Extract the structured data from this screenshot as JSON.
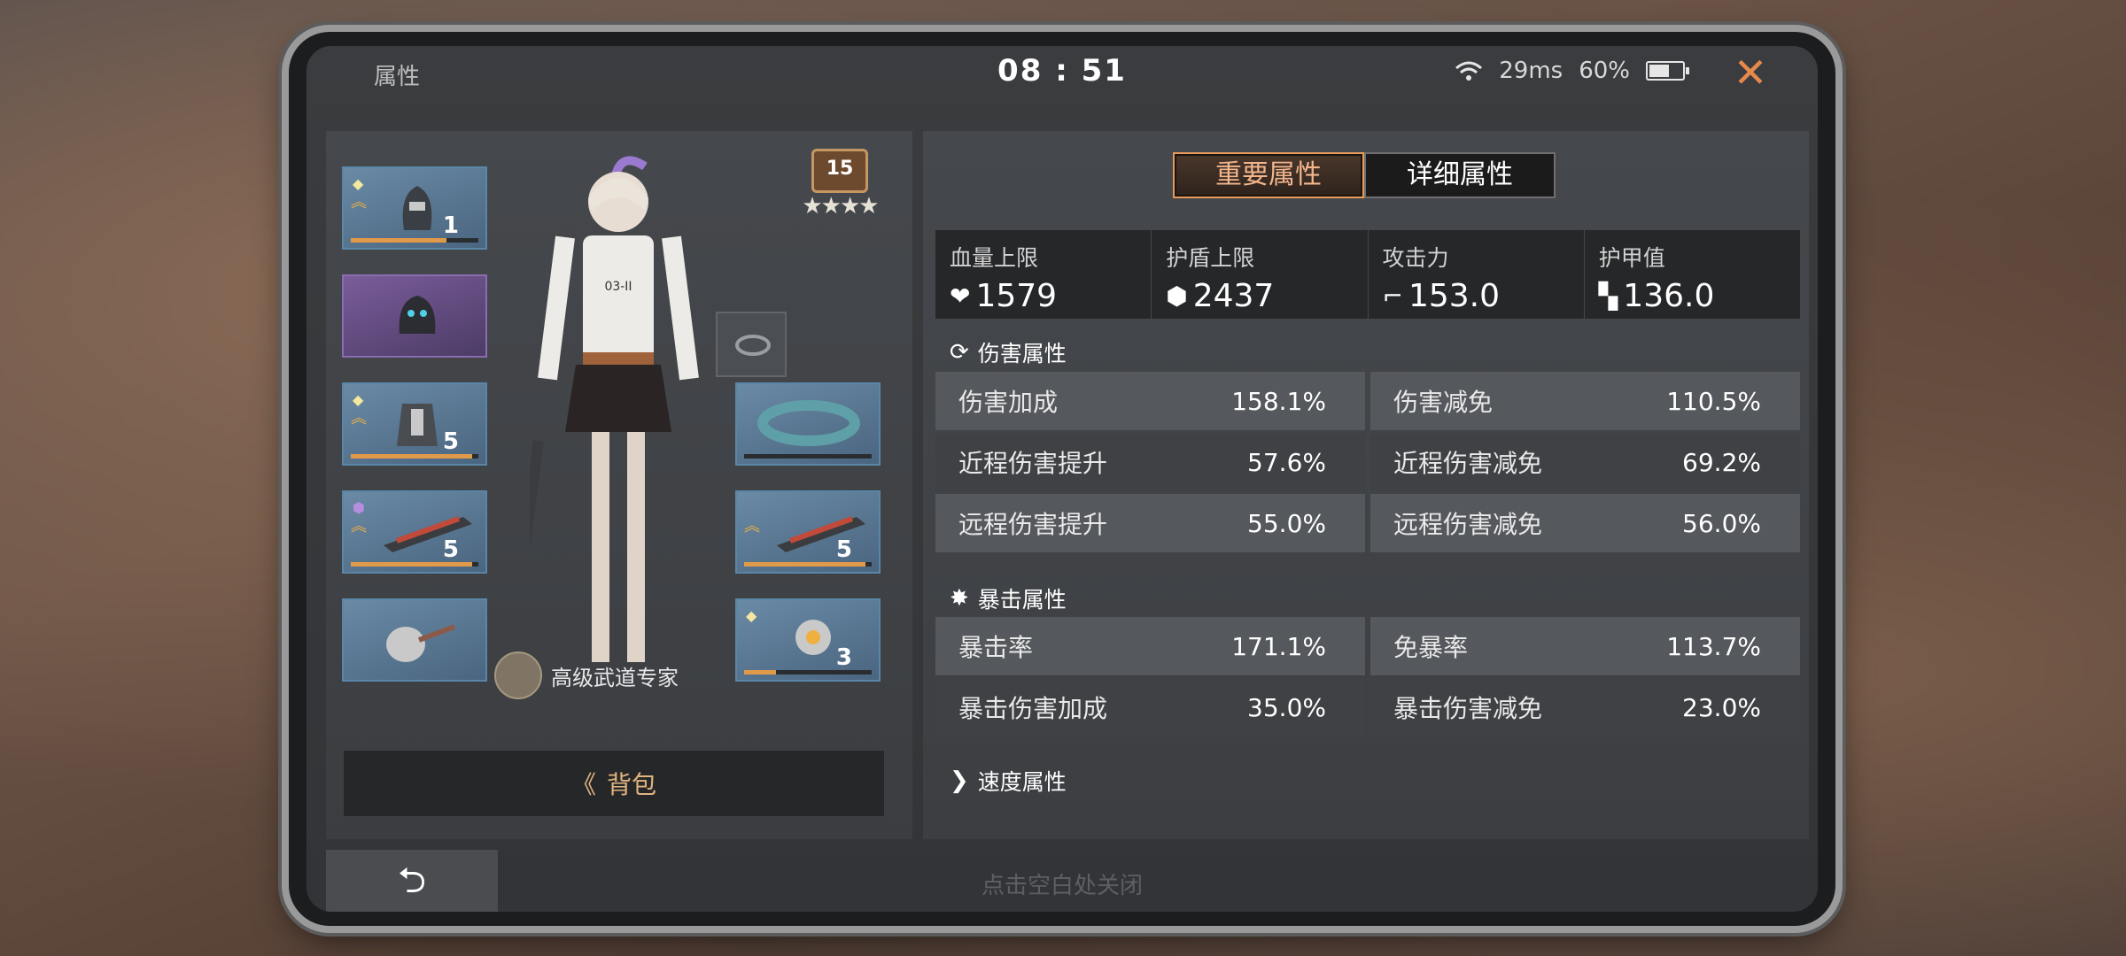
{
  "status": {
    "title": "属性",
    "time": "08 : 51",
    "ping": "29ms",
    "battery": "60%",
    "battery_level": 0.6
  },
  "left": {
    "rank_level": "15",
    "stars": "★★★★",
    "char_tag": "03-II",
    "expert_label": "高级武道专家",
    "bag_label": "背包",
    "slots": [
      {
        "level": "1",
        "progress": 0.75
      },
      {
        "level": ""
      },
      {
        "level": "5",
        "progress": 0.95
      },
      {
        "level": "5",
        "progress": 0.95
      },
      {
        "level": ""
      },
      {
        "level": "5",
        "progress": 0.95
      },
      {
        "level": "3",
        "progress": 0.25
      }
    ]
  },
  "right": {
    "tabs": [
      "重要属性",
      "详细属性"
    ],
    "summary": [
      {
        "label": "血量上限",
        "value": "1579",
        "icon": "heart-icon"
      },
      {
        "label": "护盾上限",
        "value": "2437",
        "icon": "shield-icon"
      },
      {
        "label": "攻击力",
        "value": "153.0",
        "icon": "gun-icon"
      },
      {
        "label": "护甲值",
        "value": "136.0",
        "icon": "armor-icon"
      }
    ],
    "sections": [
      {
        "title": "伤害属性",
        "rows": [
          [
            {
              "label": "伤害加成",
              "value": "158.1%"
            },
            {
              "label": "伤害减免",
              "value": "110.5%"
            }
          ],
          [
            {
              "label": "近程伤害提升",
              "value": "57.6%"
            },
            {
              "label": "近程伤害减免",
              "value": "69.2%"
            }
          ],
          [
            {
              "label": "远程伤害提升",
              "value": "55.0%"
            },
            {
              "label": "远程伤害减免",
              "value": "56.0%"
            }
          ]
        ]
      },
      {
        "title": "暴击属性",
        "rows": [
          [
            {
              "label": "暴击率",
              "value": "171.1%"
            },
            {
              "label": "免暴率",
              "value": "113.7%"
            }
          ],
          [
            {
              "label": "暴击伤害加成",
              "value": "35.0%"
            },
            {
              "label": "暴击伤害减免",
              "value": "23.0%"
            }
          ]
        ]
      },
      {
        "title": "速度属性",
        "rows": []
      }
    ]
  },
  "footer": {
    "hint": "点击空白处关闭"
  },
  "colors": {
    "accent": "#e89b58",
    "close": "#e68a4c"
  }
}
